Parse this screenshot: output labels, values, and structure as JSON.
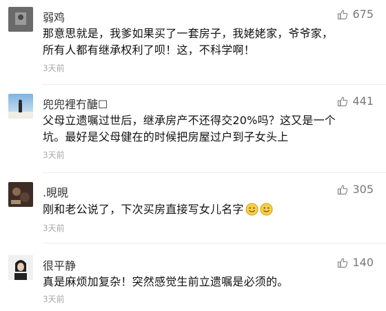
{
  "comments": [
    {
      "user": "弱鸡",
      "likes": "675",
      "lines": [
        "那意思就是，我爹如果买了一套房子，我姥姥家，爷爷家，",
        "所有人都有继承权利了呗！这，不科学啊！"
      ],
      "time": "3天前"
    },
    {
      "user": "兜兜裡冇醣☐",
      "likes": "441",
      "lines": [
        "父母立遗嘱过世后，继承房产不还得交20%吗？这又是一个",
        "坑。最好是父母健在的时候把房屋过户到子女头上"
      ],
      "time": "3天前"
    },
    {
      "user": ".晛晛",
      "likes": "305",
      "lines": [
        "刚和老公说了，下次买房直接写女儿名字"
      ],
      "time": "3天前"
    },
    {
      "user": "很平静",
      "likes": "140",
      "lines": [
        "真是麻烦加复杂！突然感觉生前立遗嘱是必须的。"
      ],
      "time": "3天前"
    }
  ],
  "icons": {
    "like": "thumbs-up-icon",
    "emoji": "smiley-emoji-icon"
  },
  "colors": {
    "text": "#111111",
    "muted": "#a8a8a8",
    "like": "#777777"
  }
}
